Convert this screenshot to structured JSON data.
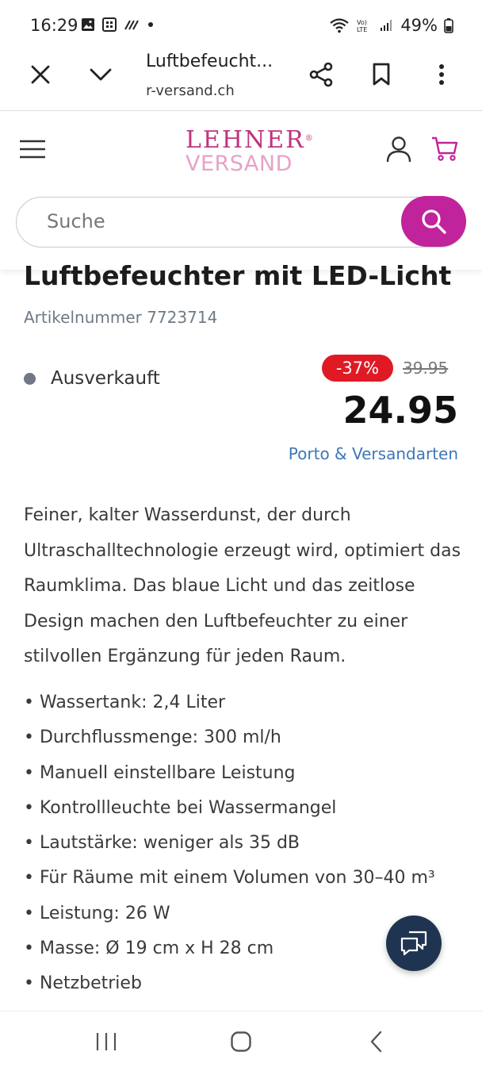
{
  "status_bar": {
    "time": "16:29",
    "battery": "49%",
    "icons": [
      "gallery-icon",
      "nfc-icon",
      "signal-pattern-icon",
      "dot-icon",
      "wifi-icon",
      "volte-icon",
      "cell-signal-icon",
      "battery-icon"
    ]
  },
  "browser": {
    "tab_title": "Luftbefeucht...",
    "url": "ler-versand.ch",
    "icons": [
      "close-icon",
      "chevron-down-icon",
      "share-icon",
      "bookmark-icon",
      "more-vert-icon"
    ]
  },
  "site": {
    "logo_top": "LEHNER",
    "logo_bottom": "VERSAND",
    "logo_registered": "®",
    "search_placeholder": "Suche",
    "brand_color": "#c0239b"
  },
  "product": {
    "title": "Luftbefeuchter mit LED-Licht",
    "article_number": "Artikelnummer 7723714",
    "stock_status": "Ausverkauft",
    "discount": "-37%",
    "old_price": "39.95",
    "price": "24.95",
    "shipping_link": "Porto & Versandarten",
    "description": "Feiner, kalter Wasserdunst, der durch Ultraschalltechnologie erzeugt wird, optimiert das Raumklima. Das blaue Licht und das zeitlose Design machen den Luftbefeuchter zu einer stilvollen Ergänzung für jeden Raum.",
    "features": [
      "• Wassertank: 2,4 Liter",
      "• Durchflussmenge: 300 ml/h",
      "• Manuell einstellbare Leistung",
      "• Kontrollleuchte bei Wassermangel",
      "• Lautstärke: weniger als 35 dB",
      "• Für Räume mit einem Volumen von 30–40 m³",
      "• Leistung: 26 W",
      "• Masse: Ø 19 cm x H 28 cm",
      "• Netzbetrieb"
    ]
  },
  "nav": {
    "icons": [
      "recent-apps-icon",
      "home-icon",
      "back-icon"
    ]
  }
}
